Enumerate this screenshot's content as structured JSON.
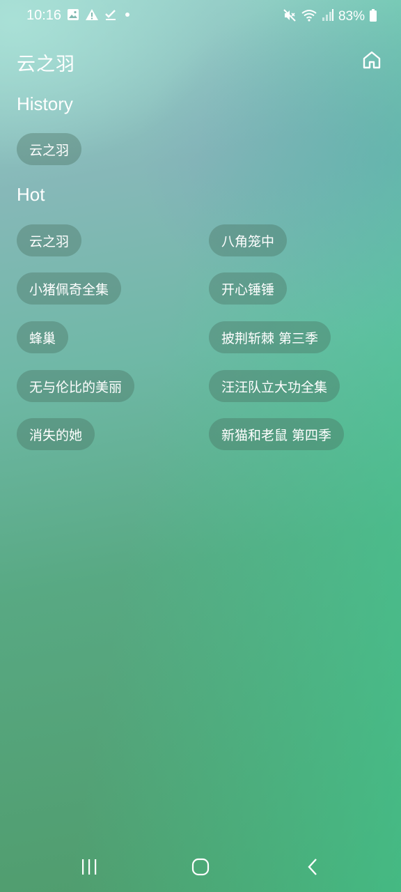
{
  "status_bar": {
    "time": "10:16",
    "battery": "83%",
    "left_icons": [
      "image-icon",
      "warning-icon",
      "check-icon",
      "dot-icon"
    ],
    "right_icons": [
      "mute-icon",
      "wifi-icon",
      "signal-icon",
      "battery-icon"
    ]
  },
  "header": {
    "title": "云之羽",
    "home_icon": "home-icon"
  },
  "history": {
    "title": "History",
    "items": [
      "云之羽"
    ]
  },
  "hot": {
    "title": "Hot",
    "items": [
      "云之羽",
      "八角笼中",
      "小猪佩奇全集",
      "开心锤锤",
      "蜂巢",
      "披荆斩棘 第三季",
      "无与伦比的美丽",
      "汪汪队立大功全集",
      "消失的她",
      "新猫和老鼠 第四季"
    ]
  },
  "nav_bar": {
    "buttons": [
      "recent-apps-icon",
      "home-circle-icon",
      "back-icon"
    ]
  },
  "colors": {
    "chip_bg": "#466e5f",
    "text": "#ffffff"
  }
}
